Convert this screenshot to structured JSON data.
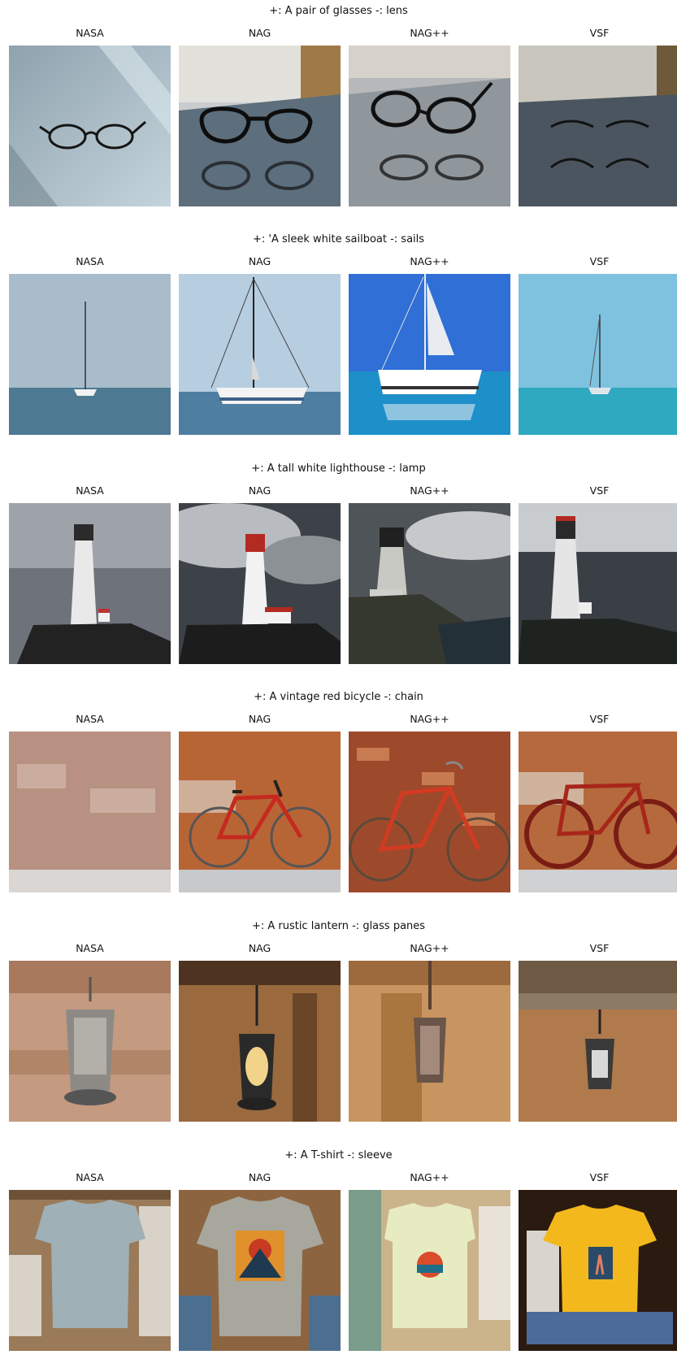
{
  "rows": [
    {
      "prompt": "+: A pair of glasses -: lens",
      "methods": [
        "NASA",
        "NAG",
        "NAG++",
        "VSF"
      ],
      "subject": "glasses"
    },
    {
      "prompt": "+: 'A sleek white sailboat -: sails",
      "methods": [
        "NASA",
        "NAG",
        "NAG++",
        "VSF"
      ],
      "subject": "sailboat"
    },
    {
      "prompt": "+: A tall white lighthouse -: lamp",
      "methods": [
        "NASA",
        "NAG",
        "NAG++",
        "VSF"
      ],
      "subject": "lighthouse"
    },
    {
      "prompt": "+: A vintage red bicycle -: chain",
      "methods": [
        "NASA",
        "NAG",
        "NAG++",
        "VSF"
      ],
      "subject": "bicycle"
    },
    {
      "prompt": "+: A rustic lantern -: glass panes",
      "methods": [
        "NASA",
        "NAG",
        "NAG++",
        "VSF"
      ],
      "subject": "lantern"
    },
    {
      "prompt": "+: A T-shirt -: sleeve",
      "methods": [
        "NASA",
        "NAG",
        "NAG++",
        "VSF"
      ],
      "subject": "tshirt"
    }
  ]
}
